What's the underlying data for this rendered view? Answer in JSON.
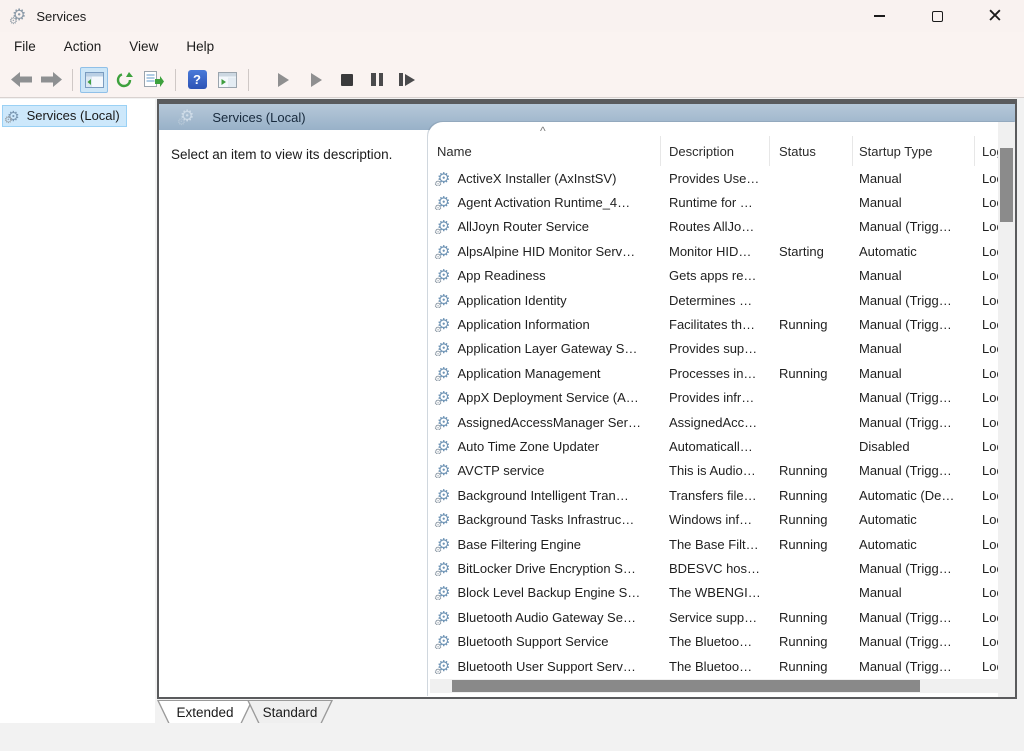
{
  "window": {
    "title": "Services",
    "controls": {
      "minimize": "minimize",
      "maximize": "maximize",
      "close": "✕"
    }
  },
  "menu": {
    "items": [
      "File",
      "Action",
      "View",
      "Help"
    ]
  },
  "toolbar": {
    "buttons": [
      "back",
      "forward",
      "show-hide-console-tree",
      "refresh",
      "export-list",
      "help",
      "show-hide-action-pane",
      "start-service",
      "resume-service",
      "stop-service",
      "pause-service",
      "restart-service"
    ],
    "help_glyph": "?"
  },
  "sidebar": {
    "items": [
      {
        "label": "Services (Local)",
        "selected": true
      }
    ]
  },
  "content": {
    "pane_header": "Services (Local)",
    "description_hint": "Select an item to view its description.",
    "sort_indicator": "^",
    "table": {
      "columns": [
        "Name",
        "Description",
        "Status",
        "Startup Type",
        "Log"
      ],
      "rows": [
        {
          "name": "ActiveX Installer (AxInstSV)",
          "description": "Provides Use…",
          "status": "",
          "startup_type": "Manual",
          "log_on_as": "Loc"
        },
        {
          "name": "Agent Activation Runtime_4…",
          "description": "Runtime for …",
          "status": "",
          "startup_type": "Manual",
          "log_on_as": "Loc"
        },
        {
          "name": "AllJoyn Router Service",
          "description": "Routes AllJo…",
          "status": "",
          "startup_type": "Manual (Trigg…",
          "log_on_as": "Loc"
        },
        {
          "name": "AlpsAlpine HID Monitor Serv…",
          "description": "Monitor HID…",
          "status": "Starting",
          "startup_type": "Automatic",
          "log_on_as": "Loc"
        },
        {
          "name": "App Readiness",
          "description": "Gets apps re…",
          "status": "",
          "startup_type": "Manual",
          "log_on_as": "Loc"
        },
        {
          "name": "Application Identity",
          "description": "Determines …",
          "status": "",
          "startup_type": "Manual (Trigg…",
          "log_on_as": "Loc"
        },
        {
          "name": "Application Information",
          "description": "Facilitates th…",
          "status": "Running",
          "startup_type": "Manual (Trigg…",
          "log_on_as": "Loc"
        },
        {
          "name": "Application Layer Gateway S…",
          "description": "Provides sup…",
          "status": "",
          "startup_type": "Manual",
          "log_on_as": "Loc"
        },
        {
          "name": "Application Management",
          "description": "Processes in…",
          "status": "Running",
          "startup_type": "Manual",
          "log_on_as": "Loc"
        },
        {
          "name": "AppX Deployment Service (A…",
          "description": "Provides infr…",
          "status": "",
          "startup_type": "Manual (Trigg…",
          "log_on_as": "Loc"
        },
        {
          "name": "AssignedAccessManager Ser…",
          "description": "AssignedAcc…",
          "status": "",
          "startup_type": "Manual (Trigg…",
          "log_on_as": "Loc"
        },
        {
          "name": "Auto Time Zone Updater",
          "description": "Automaticall…",
          "status": "",
          "startup_type": "Disabled",
          "log_on_as": "Loc"
        },
        {
          "name": "AVCTP service",
          "description": "This is Audio…",
          "status": "Running",
          "startup_type": "Manual (Trigg…",
          "log_on_as": "Loc"
        },
        {
          "name": "Background Intelligent Tran…",
          "description": "Transfers file…",
          "status": "Running",
          "startup_type": "Automatic (De…",
          "log_on_as": "Loc"
        },
        {
          "name": "Background Tasks Infrastruc…",
          "description": "Windows inf…",
          "status": "Running",
          "startup_type": "Automatic",
          "log_on_as": "Loc"
        },
        {
          "name": "Base Filtering Engine",
          "description": "The Base Filt…",
          "status": "Running",
          "startup_type": "Automatic",
          "log_on_as": "Loc"
        },
        {
          "name": "BitLocker Drive Encryption S…",
          "description": "BDESVC hos…",
          "status": "",
          "startup_type": "Manual (Trigg…",
          "log_on_as": "Loc"
        },
        {
          "name": "Block Level Backup Engine S…",
          "description": "The WBENGI…",
          "status": "",
          "startup_type": "Manual",
          "log_on_as": "Loc"
        },
        {
          "name": "Bluetooth Audio Gateway Se…",
          "description": "Service supp…",
          "status": "Running",
          "startup_type": "Manual (Trigg…",
          "log_on_as": "Loc"
        },
        {
          "name": "Bluetooth Support Service",
          "description": "The Bluetoo…",
          "status": "Running",
          "startup_type": "Manual (Trigg…",
          "log_on_as": "Loc"
        },
        {
          "name": "Bluetooth User Support Serv…",
          "description": "The Bluetoo…",
          "status": "Running",
          "startup_type": "Manual (Trigg…",
          "log_on_as": "Loc"
        }
      ]
    }
  },
  "tabs": [
    {
      "label": "Extended",
      "active": true
    },
    {
      "label": "Standard",
      "active": false
    }
  ],
  "colors": {
    "titlebar_bg": "#f9f2f0",
    "selection_bg": "#cde8fb",
    "selection_border": "#9ad1f5",
    "banner_top": "#b6c8d9",
    "banner_bottom": "#98b1c8",
    "pane_border": "#5a5b5d",
    "toolbar_active_bg": "#cde6f7",
    "scroll_thumb": "#8b8b8b",
    "gear_blue": "#6f94b5"
  }
}
